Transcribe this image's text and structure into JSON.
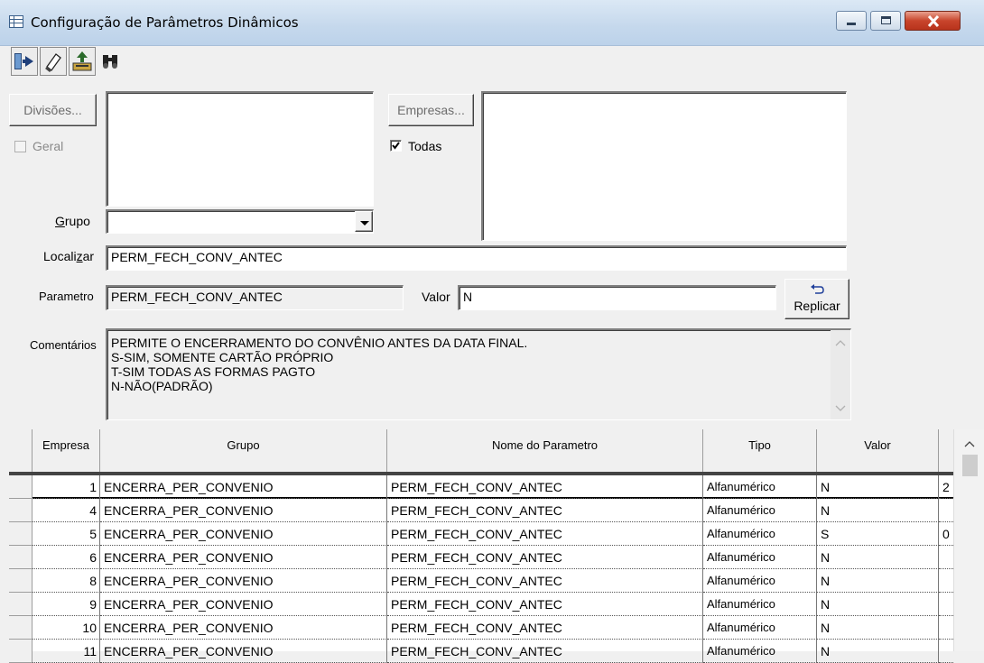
{
  "window": {
    "title": "Configuração de Parâmetros Dinâmicos"
  },
  "toolbar": {
    "items": [
      "exit-icon",
      "eraser-icon",
      "save-icon",
      "binoculars-icon"
    ]
  },
  "divisoes": {
    "button_label": "Divisões...",
    "geral_label": "Geral",
    "geral_checked": false
  },
  "empresas": {
    "button_label": "Empresas...",
    "todas_label": "Todas",
    "todas_checked": true
  },
  "grupo": {
    "label": "Grupo",
    "value": ""
  },
  "localizar": {
    "label": "Localizar",
    "value": "PERM_FECH_CONV_ANTEC"
  },
  "parametro": {
    "label": "Parametro",
    "value": "PERM_FECH_CONV_ANTEC"
  },
  "valor": {
    "label": "Valor",
    "value": "N"
  },
  "replicar": {
    "label": "Replicar"
  },
  "comentarios": {
    "label": "Comentários",
    "lines": [
      "PERMITE O ENCERRAMENTO DO CONVÊNIO ANTES DA DATA FINAL.",
      "S-SIM, SOMENTE CARTÃO PRÓPRIO",
      "T-SIM TODAS AS FORMAS PAGTO",
      "N-NÃO(PADRÃO)"
    ]
  },
  "table": {
    "headers": [
      "Empresa",
      "Grupo",
      "Nome do Parametro",
      "Tipo",
      "Valor"
    ],
    "rows": [
      {
        "empresa": "1",
        "grupo": "ENCERRA_PER_CONVENIO",
        "nome": "PERM_FECH_CONV_ANTEC",
        "tipo": "Alfanumérico",
        "valor": "N",
        "extra": "2"
      },
      {
        "empresa": "4",
        "grupo": "ENCERRA_PER_CONVENIO",
        "nome": "PERM_FECH_CONV_ANTEC",
        "tipo": "Alfanumérico",
        "valor": "N",
        "extra": ""
      },
      {
        "empresa": "5",
        "grupo": "ENCERRA_PER_CONVENIO",
        "nome": "PERM_FECH_CONV_ANTEC",
        "tipo": "Alfanumérico",
        "valor": "S",
        "extra": "0"
      },
      {
        "empresa": "6",
        "grupo": "ENCERRA_PER_CONVENIO",
        "nome": "PERM_FECH_CONV_ANTEC",
        "tipo": "Alfanumérico",
        "valor": "N",
        "extra": ""
      },
      {
        "empresa": "8",
        "grupo": "ENCERRA_PER_CONVENIO",
        "nome": "PERM_FECH_CONV_ANTEC",
        "tipo": "Alfanumérico",
        "valor": "N",
        "extra": ""
      },
      {
        "empresa": "9",
        "grupo": "ENCERRA_PER_CONVENIO",
        "nome": "PERM_FECH_CONV_ANTEC",
        "tipo": "Alfanumérico",
        "valor": "N",
        "extra": ""
      },
      {
        "empresa": "10",
        "grupo": "ENCERRA_PER_CONVENIO",
        "nome": "PERM_FECH_CONV_ANTEC",
        "tipo": "Alfanumérico",
        "valor": "N",
        "extra": ""
      },
      {
        "empresa": "11",
        "grupo": "ENCERRA_PER_CONVENIO",
        "nome": "PERM_FECH_CONV_ANTEC",
        "tipo": "Alfanumérico",
        "valor": "N",
        "extra": ""
      }
    ]
  }
}
